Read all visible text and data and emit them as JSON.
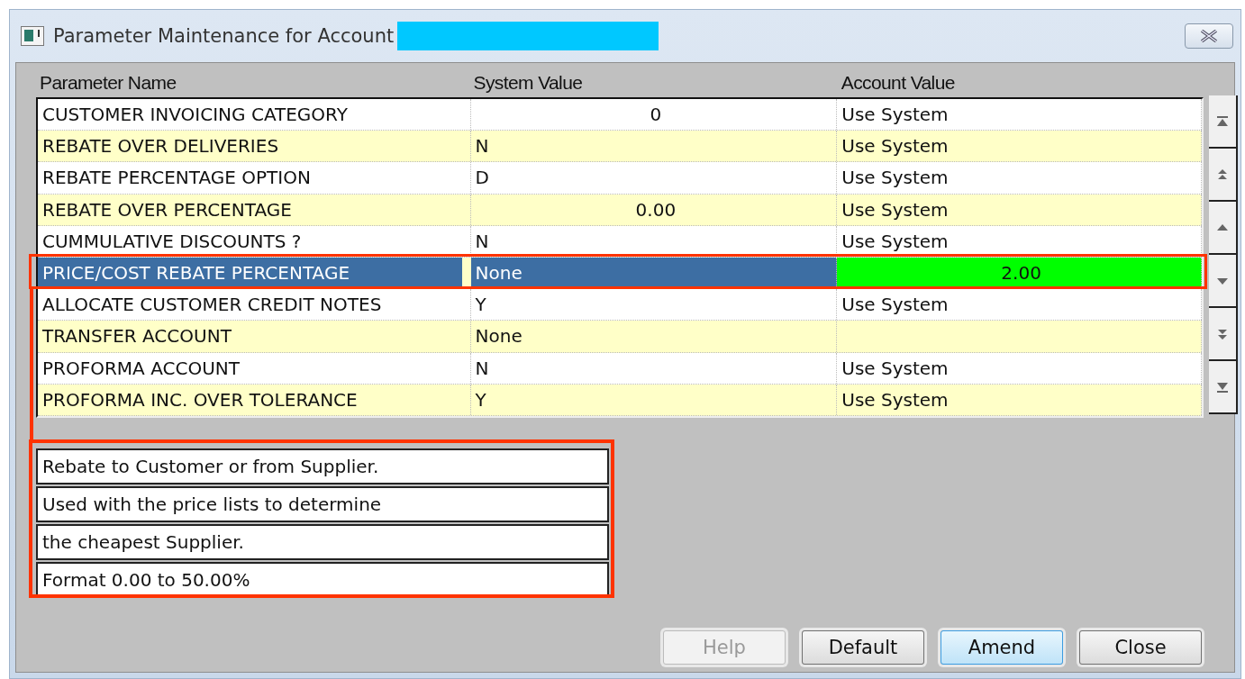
{
  "window": {
    "title": "Parameter Maintenance for Account"
  },
  "table": {
    "columns": [
      "Parameter Name",
      "System Value",
      "Account Value"
    ],
    "rows": [
      {
        "name": "CUSTOMER INVOICING CATEGORY",
        "system_value": "0",
        "system_centered": true,
        "account_value": "Use System",
        "selected": false,
        "overridden": false
      },
      {
        "name": "REBATE OVER DELIVERIES",
        "system_value": "N",
        "system_centered": false,
        "account_value": "Use System",
        "selected": false,
        "overridden": false
      },
      {
        "name": "REBATE PERCENTAGE OPTION",
        "system_value": "D",
        "system_centered": false,
        "account_value": "Use System",
        "selected": false,
        "overridden": false
      },
      {
        "name": "REBATE OVER PERCENTAGE",
        "system_value": "0.00",
        "system_centered": true,
        "account_value": "Use System",
        "selected": false,
        "overridden": false
      },
      {
        "name": "CUMMULATIVE DISCOUNTS ?",
        "system_value": "N",
        "system_centered": false,
        "account_value": "Use System",
        "selected": false,
        "overridden": false
      },
      {
        "name": "PRICE/COST REBATE PERCENTAGE",
        "system_value": "None",
        "system_centered": false,
        "account_value": "2.00",
        "selected": true,
        "overridden": true
      },
      {
        "name": "ALLOCATE CUSTOMER CREDIT NOTES",
        "system_value": "Y",
        "system_centered": false,
        "account_value": "Use System",
        "selected": false,
        "overridden": false
      },
      {
        "name": "TRANSFER ACCOUNT",
        "system_value": "None",
        "system_centered": false,
        "selected": false,
        "overridden": false
      },
      {
        "name": "PROFORMA ACCOUNT",
        "system_value": "N",
        "system_centered": false,
        "account_value": "Use System",
        "selected": false,
        "overridden": false
      },
      {
        "name": "PROFORMA INC. OVER TOLERANCE",
        "system_value": "Y",
        "system_centered": false,
        "account_value": "Use System",
        "selected": false,
        "overridden": false
      }
    ]
  },
  "help_lines": [
    "Rebate to Customer or from Supplier.",
    "Used with the price lists to determine",
    "the cheapest Supplier.",
    "Format 0.00 to 50.00%"
  ],
  "buttons": [
    {
      "label": "Help",
      "disabled": true,
      "focused": false
    },
    {
      "label": "Default",
      "disabled": false,
      "focused": false
    },
    {
      "label": "Amend",
      "disabled": false,
      "focused": true
    },
    {
      "label": "Close",
      "disabled": false,
      "focused": false
    }
  ]
}
